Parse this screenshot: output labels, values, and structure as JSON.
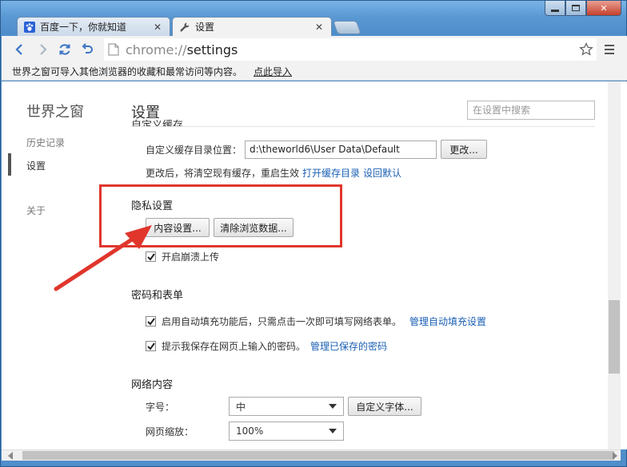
{
  "window": {
    "minimize_icon": "minimize-icon",
    "maximize_icon": "maximize-icon",
    "close_icon": "close-icon"
  },
  "tabs": [
    {
      "title": "百度一下，你就知道",
      "icon": "baidu-paw-icon",
      "active": false
    },
    {
      "title": "设置",
      "icon": "wrench-icon",
      "active": true
    }
  ],
  "omnibox": {
    "scheme": "chrome://",
    "host": "settings"
  },
  "infobar": {
    "message": "世界之窗可导入其他浏览器的收藏和最常访问等内容。",
    "link": "点此导入"
  },
  "sidebar": {
    "brand": "世界之窗",
    "items": [
      {
        "label": "历史记录",
        "selected": false
      },
      {
        "label": "设置",
        "selected": true
      },
      {
        "label": "关于",
        "selected": false
      }
    ]
  },
  "main": {
    "title": "设置",
    "search_placeholder": "在设置中搜索",
    "clipped_heading": "自定义缓存",
    "cache": {
      "label": "自定义缓存目录位置：",
      "path_value": "d:\\theworld6\\User Data\\Default",
      "change_button": "更改...",
      "note": "更改后，将清空现有缓存，重启生效",
      "open_link": "打开缓存目录",
      "reset_link": "设回默认"
    },
    "privacy": {
      "title": "隐私设置",
      "content_settings_button": "内容设置...",
      "clear_data_button": "清除浏览数据...",
      "crash_upload_label": "开启崩溃上传",
      "crash_upload_checked": true
    },
    "passwords": {
      "title": "密码和表单",
      "autofill_label": "启用自动填充功能后，只需点击一次即可填写网络表单。",
      "autofill_link": "管理自动填充设置",
      "autofill_checked": true,
      "save_pw_label": "提示我保存在网页上输入的密码。",
      "save_pw_link": "管理已保存的密码",
      "save_pw_checked": true
    },
    "web_content": {
      "title": "网络内容",
      "font_size_label": "字号：",
      "font_size_value": "中",
      "custom_fonts_button": "自定义字体...",
      "zoom_label": "网页缩放：",
      "zoom_value": "100%"
    }
  },
  "colors": {
    "annotation_red": "#e0362c",
    "link_blue": "#1a5fb4"
  }
}
